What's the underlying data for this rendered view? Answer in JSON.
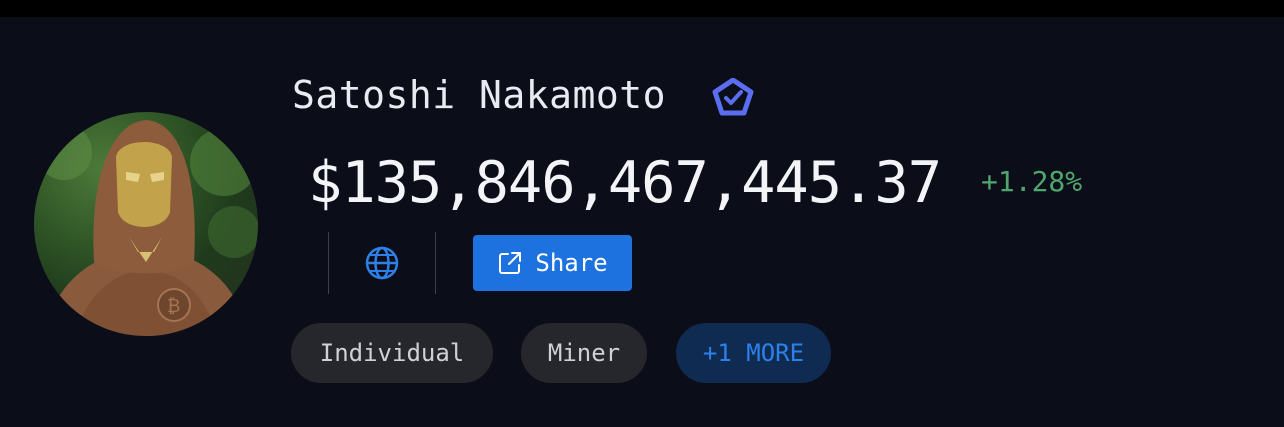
{
  "profile": {
    "name": "Satoshi Nakamoto",
    "balance": "$135,846,467,445.37",
    "change": "+1.28%",
    "share_label": "Share"
  },
  "tags": [
    {
      "label": "Individual"
    },
    {
      "label": "Miner"
    },
    {
      "label": "+1 MORE"
    }
  ],
  "icons": {
    "verified": "verified-badge-icon",
    "website": "globe-icon",
    "share": "external-link-icon"
  },
  "colors": {
    "background": "#0b0e19",
    "positive_change": "#4fa76b",
    "accent_blue": "#1d72e0",
    "verify_badge": "#5b6df0"
  }
}
